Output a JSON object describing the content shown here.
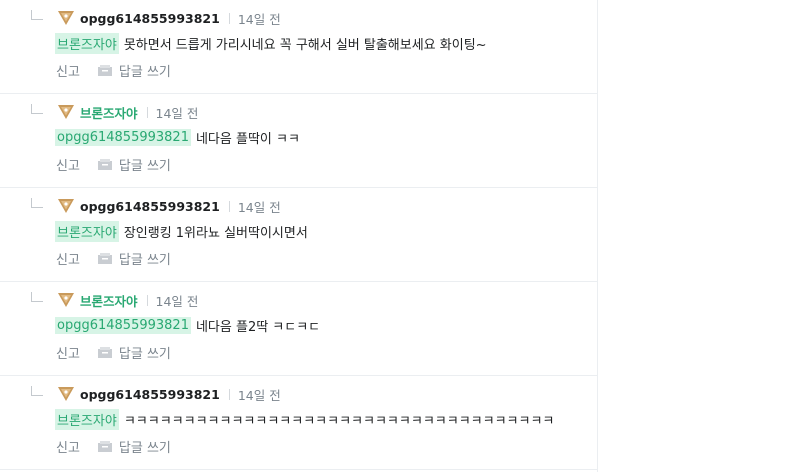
{
  "colors": {
    "mention_bg": "#d7f4e6",
    "green": "#29a872",
    "gray_text": "#7b858e",
    "divider": "#ebeef1"
  },
  "icons": {
    "tier": "bronze-tier-icon",
    "reply": "reply-box-icon",
    "connector": "reply-indent-icon"
  },
  "labels": {
    "report": "신고",
    "reply": "답글 쓰기"
  },
  "replies": [
    {
      "author": "opgg614855993821",
      "time": "14일 전",
      "mention": "브론즈자야",
      "text": "못하면서 드릅게 가리시네요 꼭 구해서 실버 탈출해보세요 화이팅~"
    },
    {
      "author": "브론즈자야",
      "time": "14일 전",
      "mention": "opgg614855993821",
      "text": "네다음 플딱이 ㅋㅋ"
    },
    {
      "author": "opgg614855993821",
      "time": "14일 전",
      "mention": "브론즈자야",
      "text": "장인랭킹 1위라뇨 실버딱이시면서"
    },
    {
      "author": "브론즈자야",
      "time": "14일 전",
      "mention": "opgg614855993821",
      "text": "네다음 플2딱 ㅋㄷㅋㄷ"
    },
    {
      "author": "opgg614855993821",
      "time": "14일 전",
      "mention": "브론즈자야",
      "text": "ㅋㅋㅋㅋㅋㅋㅋㅋㅋㅋㅋㅋㅋㅋㅋㅋㅋㅋㅋㅋㅋㅋㅋㅋㅋㅋㅋㅋㅋㅋㅋㅋㅋㅋㅋㅋ"
    }
  ]
}
